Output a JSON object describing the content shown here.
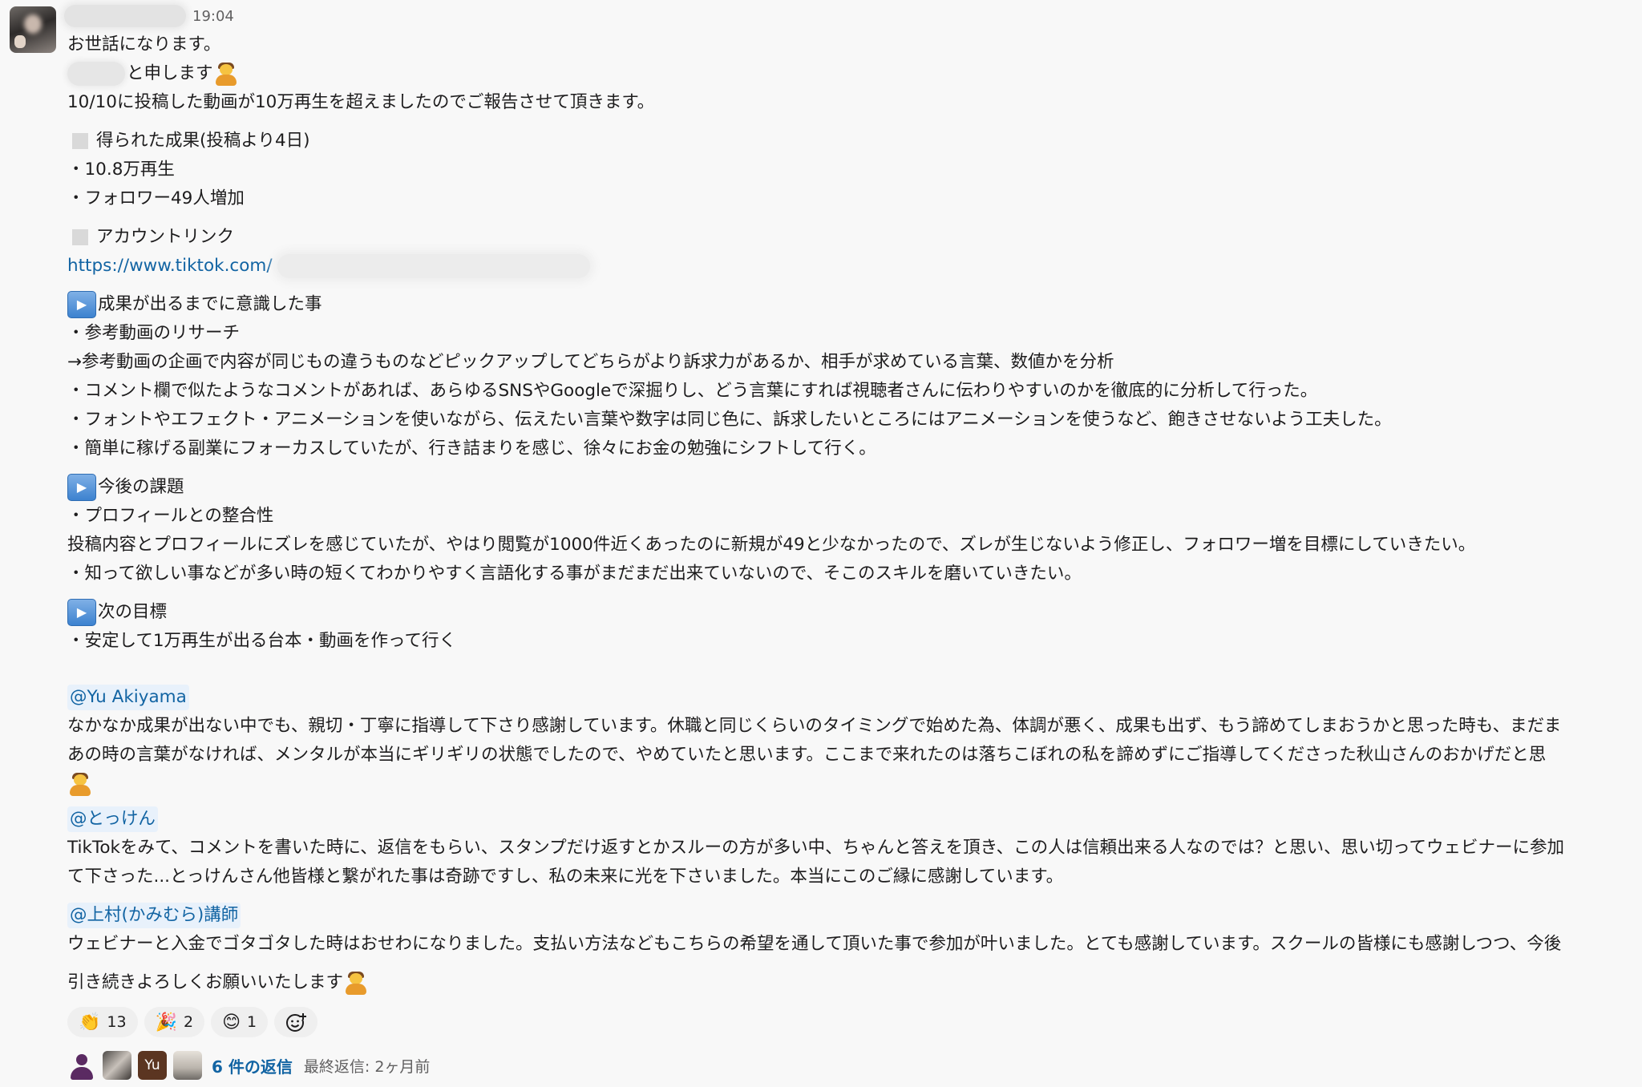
{
  "message": {
    "time": "19:04",
    "lines": {
      "greeting": "お世話になります。",
      "intro_suffix": "と申します",
      "report": "10/10に投稿した動画が10万再生を超えましたのでご報告させて頂きます。",
      "results_heading": "得られた成果(投稿より4日)",
      "results_1": "・10.8万再生",
      "results_2": "・フォロワー49人増加",
      "account_heading": "アカウントリンク",
      "account_url": "https://www.tiktok.com/",
      "focus_heading": "成果が出るまでに意識した事",
      "focus_1": "・参考動画のリサーチ",
      "focus_2": "→参考動画の企画で内容が同じもの違うものなどピックアップしてどちらがより訴求力があるか、相手が求めている言葉、数値かを分析",
      "focus_3": "・コメント欄で似たようなコメントがあれば、あらゆるSNSやGoogleで深掘りし、どう言葉にすれば視聴者さんに伝わりやすいのかを徹底的に分析して行った。",
      "focus_4": "・フォントやエフェクト・アニメーションを使いながら、伝えたい言葉や数字は同じ色に、訴求したいところにはアニメーションを使うなど、飽きさせないよう工夫した。",
      "focus_5": "・簡単に稼げる副業にフォーカスしていたが、行き詰まりを感じ、徐々にお金の勉強にシフトして行く。",
      "future_heading": "今後の課題",
      "future_1": "・プロフィールとの整合性",
      "future_2": "投稿内容とプロフィールにズレを感じていたが、やはり閲覧が1000件近くあったのに新規が49と少なかったので、ズレが生じないよう修正し、フォロワー増を目標にしていきたい。",
      "future_3": "・知って欲しい事などが多い時の短くてわかりやすく言語化する事がまだまだ出来ていないので、そこのスキルを磨いていきたい。",
      "next_heading": "次の目標",
      "next_1": "・安定して1万再生が出る台本・動画を作って行く",
      "mention_1": "@Yu Akiyama",
      "thanks_1a": "なかなか成果が出ない中でも、親切・丁寧に指導して下さり感謝しています。休職と同じくらいのタイミングで始めた為、体調が悪く、成果も出ず、もう諦めてしまおうかと思った時も、まだま",
      "thanks_1b": "あの時の言葉がなければ、メンタルが本当にギリギリの状態でしたので、やめていたと思います。ここまで来れたのは落ちこぼれの私を諦めずにご指導してくださった秋山さんのおかげだと思",
      "mention_2": "@とっけん",
      "thanks_2a": "TikTokをみて、コメントを書いた時に、返信をもらい、スタンプだけ返すとかスルーの方が多い中、ちゃんと答えを頂き、この人は信頼出来る人なのでは？と思い、思い切ってウェビナーに参加",
      "thanks_2b": "て下さった...とっけんさん他皆様と繋がれた事は奇跡ですし、私の未来に光を下さいました。本当にこのご縁に感謝しています。",
      "mention_3": "@上村(かみむら)講師",
      "thanks_3": "ウェビナーと入金でゴタゴタした時はおせわになりました。支払い方法などもこちらの希望を通して頂いた事で参加が叶いました。とても感謝しています。スクールの皆様にも感謝しつつ、今後",
      "closing": "引き続きよろしくお願いいたします"
    }
  },
  "reactions": [
    {
      "emoji": "👏",
      "icon": "clap-emoji",
      "count": "13"
    },
    {
      "emoji": "🎉",
      "icon": "party-popper-emoji",
      "count": "2"
    },
    {
      "emoji": "😊",
      "icon": "smile-emoji",
      "count": "1"
    }
  ],
  "thread": {
    "avatar_initials": "Yu",
    "reply_count": "6 件の返信",
    "last_reply": "最終返信: 2ヶ月前"
  },
  "colors": {
    "link": "#1264a3",
    "mention_bg": "#e8f1fb",
    "background": "#f8f8f8"
  }
}
